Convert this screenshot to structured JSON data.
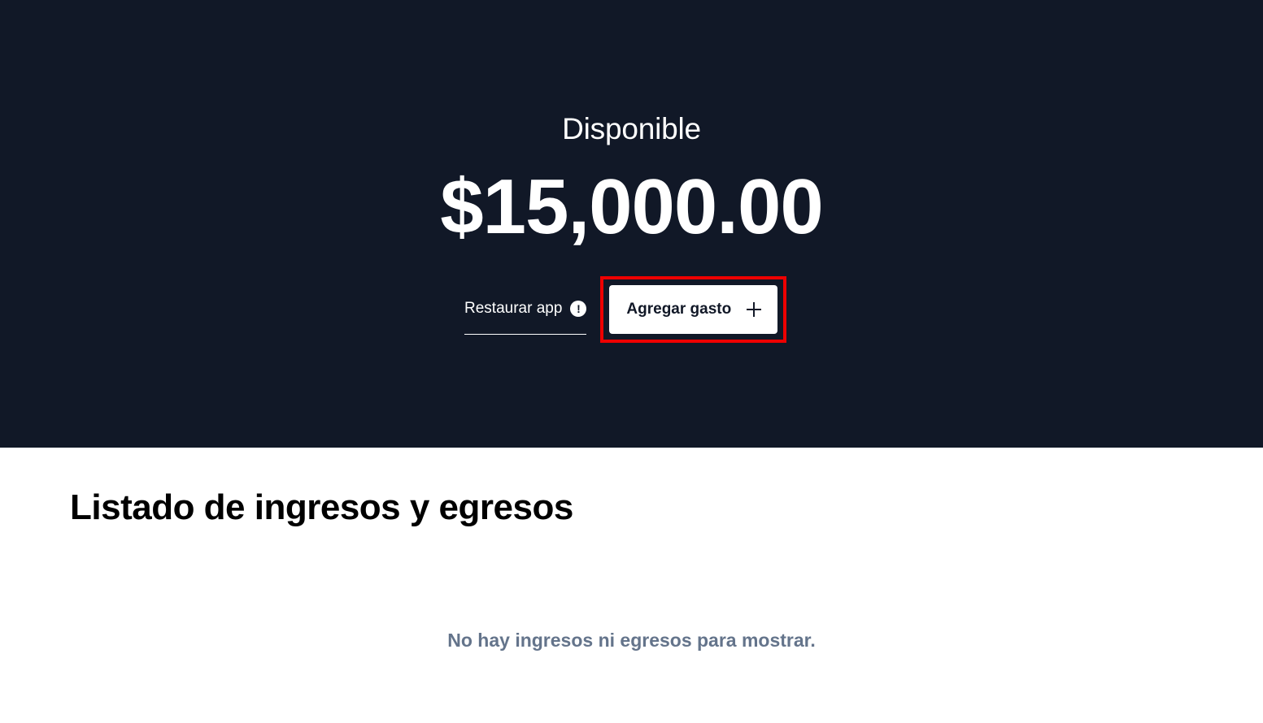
{
  "hero": {
    "label": "Disponible",
    "amount": "$15,000.00",
    "background_color": "#111827"
  },
  "actions": {
    "restore_label": "Restaurar app",
    "restore_icon": "alert-circle-icon",
    "add_label": "Agregar gasto",
    "add_icon": "plus-icon",
    "highlight_color": "#ee0000"
  },
  "list": {
    "title": "Listado de ingresos y egresos",
    "empty_message": "No hay ingresos ni egresos para mostrar."
  }
}
